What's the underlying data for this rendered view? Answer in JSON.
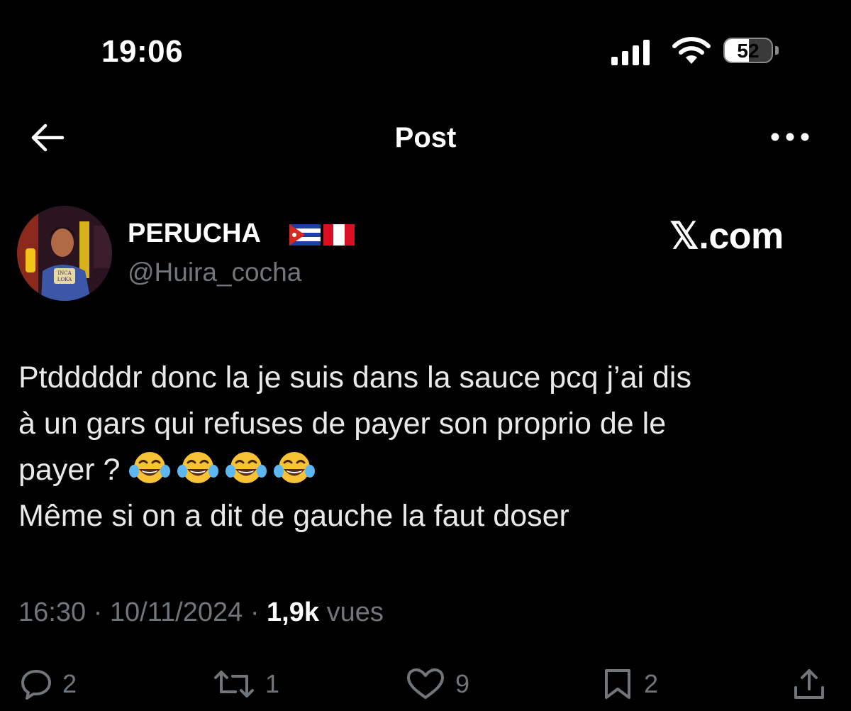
{
  "status_bar": {
    "time": "19:06",
    "battery": "52",
    "battery_level": 0.52
  },
  "nav": {
    "title": "Post"
  },
  "author": {
    "name": "PERUCHA",
    "handle": "@Huira_cocha",
    "flags": [
      "cuba-flag",
      "peru-flag"
    ],
    "avatar_text": [
      "INCA",
      "LOKA"
    ]
  },
  "watermark": "𝕏.com",
  "tweet": {
    "text_lines": [
      "Ptdddddr donc la je suis dans la sauce pcq j’ai dis",
      "à un gars qui refuses de payer son proprio de le",
      "payer ?",
      "Même si on a dit de gauche la faut doser"
    ],
    "emojis": [
      "face-with-tears-of-joy-icon",
      "face-with-tears-of-joy-icon",
      "face-with-tears-of-joy-icon",
      "face-with-tears-of-joy-icon"
    ]
  },
  "meta": {
    "time": "16:30",
    "separator": "·",
    "date": "10/11/2024",
    "views_count": "1,9k",
    "views_label": "vues"
  },
  "actions": {
    "replies": "2",
    "reposts": "1",
    "likes": "9",
    "bookmarks": "2"
  },
  "colors": {
    "background": "#000000",
    "text": "#e7e9ea",
    "muted": "#71767b"
  }
}
